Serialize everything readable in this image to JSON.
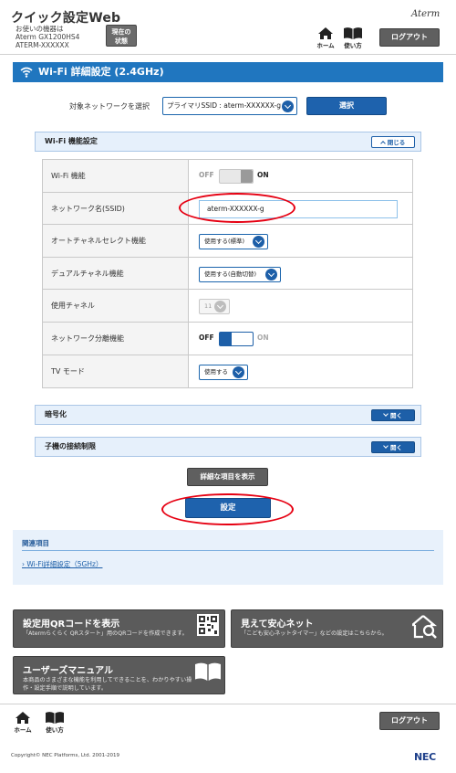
{
  "header": {
    "app_title": "クイック設定Web",
    "model_lines": [
      "お使いの機器は",
      "Aterm GX1200HS4",
      "ATERM-XXXXXX"
    ],
    "status_button": [
      "現在の",
      "状態"
    ],
    "brand": "Aterm",
    "nav_home": "ホーム",
    "nav_help": "使い方",
    "logout": "ログアウト"
  },
  "page": {
    "title": "Wi-Fi 詳細設定 (2.4GHz)"
  },
  "network_select": {
    "label": "対象ネットワークを選択",
    "value": "プライマリSSID : aterm-XXXXXX-g",
    "button": "選択"
  },
  "wifi_section": {
    "title": "Wi-Fi 機能設定",
    "toggle_label": "閉じる",
    "rows": {
      "wifi_function": {
        "label": "Wi-Fi 機能",
        "off": "OFF",
        "on": "ON",
        "state": "ON"
      },
      "ssid": {
        "label": "ネットワーク名(SSID)",
        "value": "aterm-XXXXXX-g"
      },
      "auto_channel": {
        "label": "オートチャネルセレクト機能",
        "value": "使用する(標準)"
      },
      "dual_channel": {
        "label": "デュアルチャネル機能",
        "value": "使用する(自動切替)"
      },
      "channel": {
        "label": "使用チャネル",
        "value": "11"
      },
      "network_isolation": {
        "label": "ネットワーク分離機能",
        "off": "OFF",
        "on": "ON",
        "state": "OFF"
      },
      "tv_mode": {
        "label": "TV モード",
        "value": "使用する"
      }
    }
  },
  "encryption_section": {
    "title": "暗号化",
    "toggle_label": "開く"
  },
  "client_limit_section": {
    "title": "子機の接続制限",
    "toggle_label": "開く"
  },
  "buttons": {
    "show_details": "詳細な項目を表示",
    "apply": "設定"
  },
  "related": {
    "title": "関連項目",
    "link": "Wi-Fi詳細設定（5GHz）"
  },
  "cards": {
    "qr": {
      "title": "設定用QRコードを表示",
      "desc": "「Atermらくらく QRスタート」用のQRコードを作成できます。"
    },
    "safety": {
      "title": "見えて安心ネット",
      "desc": "「こども安心ネットタイマー」などの設定はこちらから。"
    },
    "manual": {
      "title": "ユーザーズマニュアル",
      "desc_lines": [
        "本商品のさまざまな機能を利用してできることを、わかりやすい操",
        "作・設定手順で説明しています。"
      ]
    }
  },
  "footer": {
    "nav_home": "ホーム",
    "nav_help": "使い方",
    "logout": "ログアウト",
    "copyright": "Copyright© NEC Platforms, Ltd. 2001-2019",
    "nec": "NEC"
  },
  "colors": {
    "accent_blue": "#2076bf",
    "highlight_red": "#e60012",
    "button_gray": "#5f5f5f"
  }
}
